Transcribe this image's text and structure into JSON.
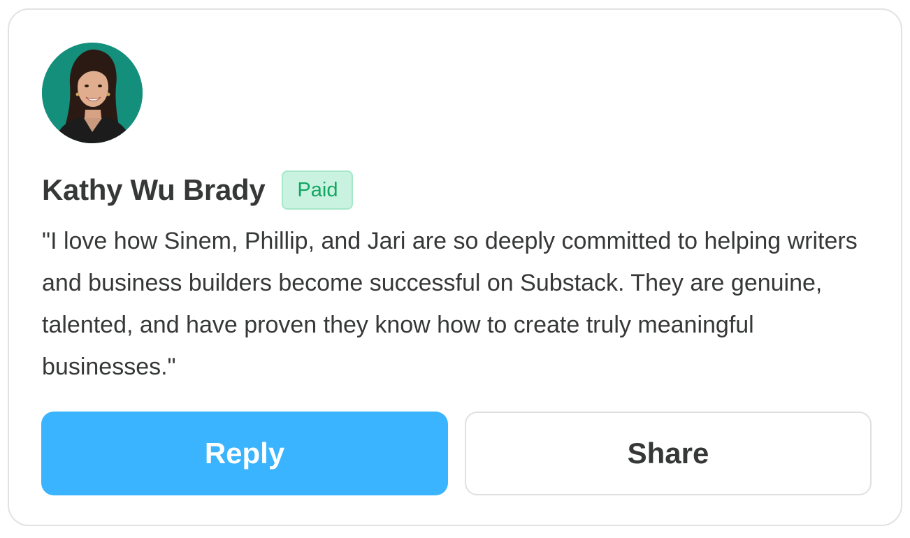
{
  "comment": {
    "author": {
      "name": "Kathy Wu Brady",
      "badge": "Paid",
      "avatar_icon": "user-avatar-photo"
    },
    "text": "\"I love how Sinem, Phillip, and Jari are so deeply committed to helping writers and business builders become successful on Substack. They are genuine, talented, and have proven they know how to create truly meaningful businesses.\""
  },
  "actions": {
    "reply_label": "Reply",
    "share_label": "Share"
  },
  "colors": {
    "accent": "#3ab4ff",
    "badge_text": "#13a562",
    "badge_bg": "#c9f3e0",
    "avatar_bg": "#138f7b",
    "text": "#363737",
    "border": "#e2e2e2"
  }
}
